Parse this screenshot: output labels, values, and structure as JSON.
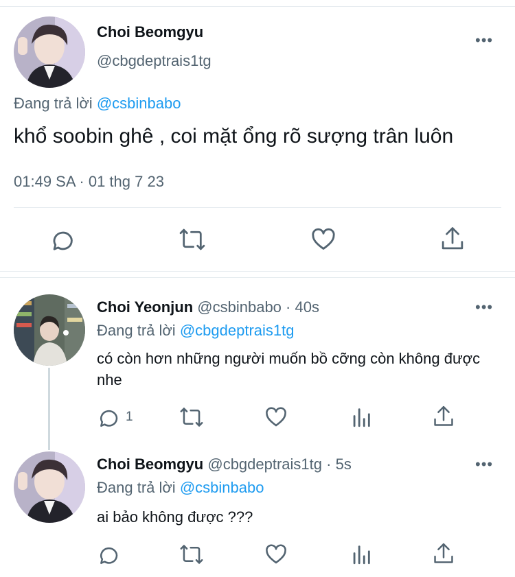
{
  "main_tweet": {
    "author_name": "Choi Beomgyu",
    "author_handle": "@cbgdeptrais1tg",
    "more": "•••",
    "replying_prefix": "Đang trả lời",
    "replying_to": "@csbinbabo",
    "text": "khổ soobin ghê , coi mặt ổng rõ sượng trân luôn",
    "timestamp": "01:49 SA · 01 thg 7 23"
  },
  "replies": [
    {
      "author_name": "Choi Yeonjun",
      "author_handle": "@csbinbabo",
      "time": "· 40s",
      "more": "•••",
      "replying_prefix": "Đang trả lời",
      "replying_to": "@cbgdeptrais1tg",
      "text": "có còn hơn những người muốn bồ cỡng còn không được nhe",
      "reply_count": "1"
    },
    {
      "author_name": "Choi Beomgyu",
      "author_handle": "@cbgdeptrais1tg",
      "time": "· 5s",
      "more": "•••",
      "replying_prefix": "Đang trả lời",
      "replying_to": "@csbinbabo",
      "text": "ai bảo không được ???",
      "reply_count": ""
    }
  ],
  "icons": {
    "reply": "comment-bubble-icon",
    "retweet": "retweet-icon",
    "like": "heart-icon",
    "share": "share-icon",
    "analytics": "analytics-icon",
    "more": "more-dots-icon"
  },
  "colors": {
    "link": "#1d9bf0",
    "muted": "#536471",
    "text": "#0f1419",
    "divider": "#e6ecf0"
  }
}
